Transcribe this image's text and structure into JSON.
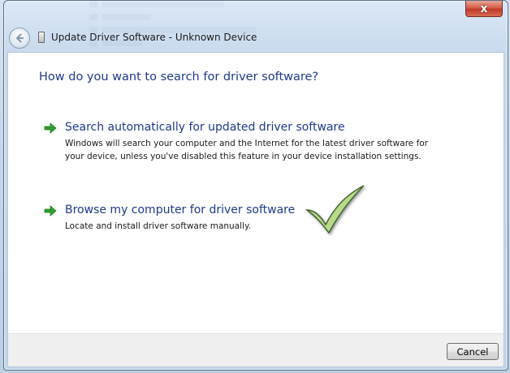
{
  "window": {
    "title": "Update Driver Software - Unknown Device",
    "close_label": "x"
  },
  "dialog": {
    "heading": "How do you want to search for driver software?",
    "options": [
      {
        "title": "Search automatically for updated driver software",
        "description": "Windows will search your computer and the Internet for the latest driver software for your device, unless you've disabled this feature in your device installation settings."
      },
      {
        "title": "Browse my computer for driver software",
        "description": "Locate and install driver software manually."
      }
    ]
  },
  "footer": {
    "cancel_label": "Cancel"
  },
  "icons": {
    "back": "back-arrow-icon",
    "device": "device-icon",
    "option_arrow": "green-arrow-icon",
    "annotation": "checkmark-icon"
  },
  "colors": {
    "heading_blue": "#1e3a8c",
    "arrow_green": "#2ea02e",
    "close_red": "#c0392b",
    "check_green": "#b8d98a"
  }
}
